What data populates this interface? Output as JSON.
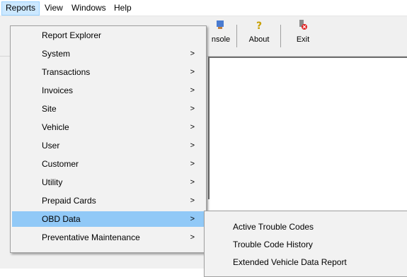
{
  "menubar": {
    "items": [
      {
        "label": "Reports"
      },
      {
        "label": "View"
      },
      {
        "label": "Windows"
      },
      {
        "label": "Help"
      }
    ]
  },
  "toolbar": {
    "buttons": [
      {
        "label": "nsole",
        "icon": "console-icon"
      },
      {
        "label": "About",
        "icon": "about-icon"
      },
      {
        "label": "Exit",
        "icon": "exit-icon"
      }
    ]
  },
  "reports_menu": {
    "items": [
      {
        "label": "Report Explorer",
        "has_submenu": false
      },
      {
        "label": "System",
        "has_submenu": true
      },
      {
        "label": "Transactions",
        "has_submenu": true
      },
      {
        "label": "Invoices",
        "has_submenu": true
      },
      {
        "label": "Site",
        "has_submenu": true
      },
      {
        "label": "Vehicle",
        "has_submenu": true
      },
      {
        "label": "User",
        "has_submenu": true
      },
      {
        "label": "Customer",
        "has_submenu": true
      },
      {
        "label": "Utility",
        "has_submenu": true
      },
      {
        "label": "Prepaid Cards",
        "has_submenu": true
      },
      {
        "label": "OBD Data",
        "has_submenu": true,
        "highlighted": true
      },
      {
        "label": "Preventative Maintenance",
        "has_submenu": true
      }
    ],
    "arrow": ">"
  },
  "obd_submenu": {
    "items": [
      {
        "label": "Active Trouble Codes"
      },
      {
        "label": "Trouble Code History"
      },
      {
        "label": "Extended Vehicle Data Report"
      }
    ]
  },
  "colors": {
    "highlight": "#91c9f7",
    "menu_bg": "#f2f2f2",
    "active_top": "#cce8ff"
  }
}
